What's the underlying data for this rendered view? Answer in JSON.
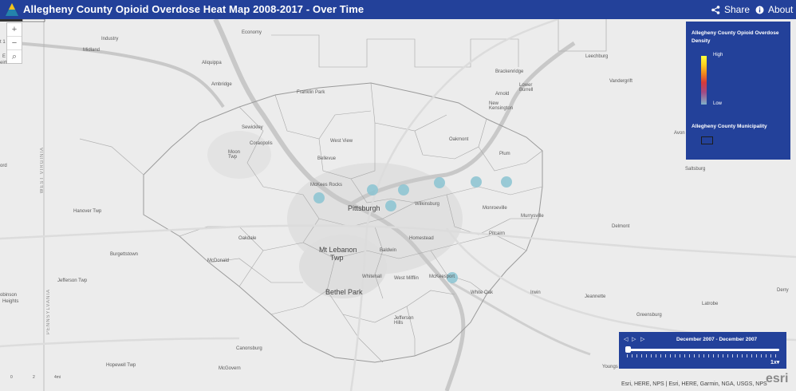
{
  "header": {
    "title": "Allegheny County Opioid Overdose Heat Map 2008-2017 - Over Time",
    "share_label": "Share",
    "about_label": "About"
  },
  "zoom": {
    "in": "+",
    "out": "−",
    "search": "⌕"
  },
  "legend": {
    "title": "Allegheny County Opioid Overdose Density",
    "high": "High",
    "low": "Low",
    "layer2": "Allegheny County Municipality",
    "ramp_colors": [
      "#ffff3a",
      "#ffd21e",
      "#f08a1c",
      "#d63a3a",
      "#a24b86",
      "#7fb0c8"
    ]
  },
  "time_slider": {
    "range": "December 2007 - December 2007",
    "prev": "◁",
    "play": "▷",
    "next": "▷",
    "speed": "1x",
    "speed_arrow": "▾"
  },
  "places": {
    "pittsburgh": "Pittsburgh",
    "mt_lebanon": "Mt Lebanon",
    "twp": "Twp",
    "bethel_park": "Bethel Park",
    "industry": "Industry",
    "midland": "Midland",
    "aliquippa": "Aliquippa",
    "ambridge": "Ambridge",
    "economy": "Economy",
    "franklin_park": "Franklin Park",
    "sewickley": "Sewickley",
    "coraopolis": "Coraopolis",
    "moon_twp": "Moon\nTwp",
    "west_view": "West View",
    "bellevue": "Bellevue",
    "mckees_rocks": "McKees Rocks",
    "oakmont": "Oakmont",
    "plum": "Plum",
    "brackenridge": "Brackenridge",
    "lower_burrell": "Lower\nBurrell",
    "arnold": "Arnold",
    "new_kensington": "New\nKensington",
    "leechburg": "Leechburg",
    "vandergrift": "Vandergrift",
    "avonmore": "Avon",
    "saltsburg": "Saltsburg",
    "wilkinsburg": "Wilkinsburg",
    "monroeville": "Monroeville",
    "murrysville": "Murrysville",
    "pitcairn": "Pitcairn",
    "delmont": "Delmont",
    "hanover_twp": "Hanover Twp",
    "oakdale": "Oakdale",
    "burgettstown": "Burgettstown",
    "mcdonald": "McDonald",
    "jefferson_twp": "Jefferson Twp",
    "robinson": "obinson",
    "heights": "Heights",
    "baldwin": "Baldwin",
    "homestead": "Homestead",
    "whitehall": "Whitehall",
    "west_mifflin": "West Mifflin",
    "mckeesport": "McKeesport",
    "white_oak": "White Oak",
    "irwin": "Irwin",
    "jeannette": "Jeannette",
    "greensburg": "Greensburg",
    "latrobe": "Latrobe",
    "derry": "Derry",
    "jefferson_hills": "Jefferson\nHills",
    "canonsburg": "Canonsburg",
    "hopewell": "Hopewell Twp",
    "mcgovern": "McGovern",
    "youngwood": "Youngs",
    "west_virginia": "WEST VIRGINIA",
    "pennsylvania": "PENNSYLVANIA",
    "weirton_top": "E",
    "weirton": "eirton",
    "ord": "ord",
    "t1": "t 1"
  },
  "scale": {
    "zero": "0",
    "two": "2",
    "four": "4mi"
  },
  "attribution": "Esri, HERE, NPS | Esri, HERE, Garmin, NGA, USGS, NPS",
  "esri_logo": "esri"
}
